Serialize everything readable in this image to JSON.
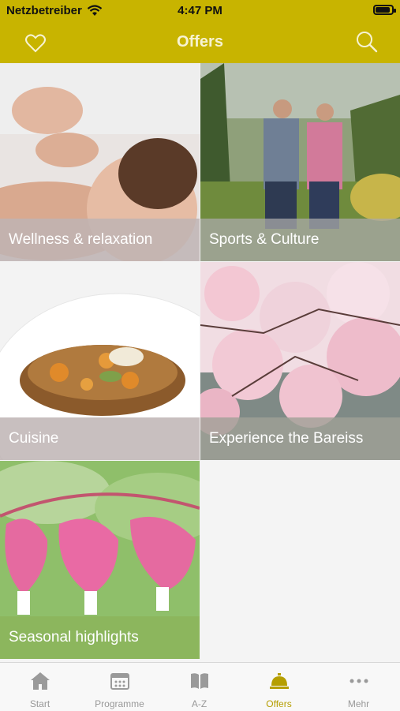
{
  "status": {
    "carrier": "Netzbetreiber",
    "time": "4:47 PM"
  },
  "nav": {
    "title": "Offers"
  },
  "tiles": [
    {
      "label": "Wellness & relaxation"
    },
    {
      "label": "Sports & Culture"
    },
    {
      "label": "Cuisine"
    },
    {
      "label": "Experience the Bareiss"
    },
    {
      "label": "Seasonal highlights"
    }
  ],
  "tabs": [
    {
      "label": "Start",
      "icon": "home-icon"
    },
    {
      "label": "Programme",
      "icon": "calendar-icon"
    },
    {
      "label": "A-Z",
      "icon": "book-icon"
    },
    {
      "label": "Offers",
      "icon": "service-bell-icon",
      "active": true
    },
    {
      "label": "Mehr",
      "icon": "more-icon"
    }
  ],
  "colors": {
    "accent": "#c8b400",
    "active_tab": "#b59e00"
  }
}
